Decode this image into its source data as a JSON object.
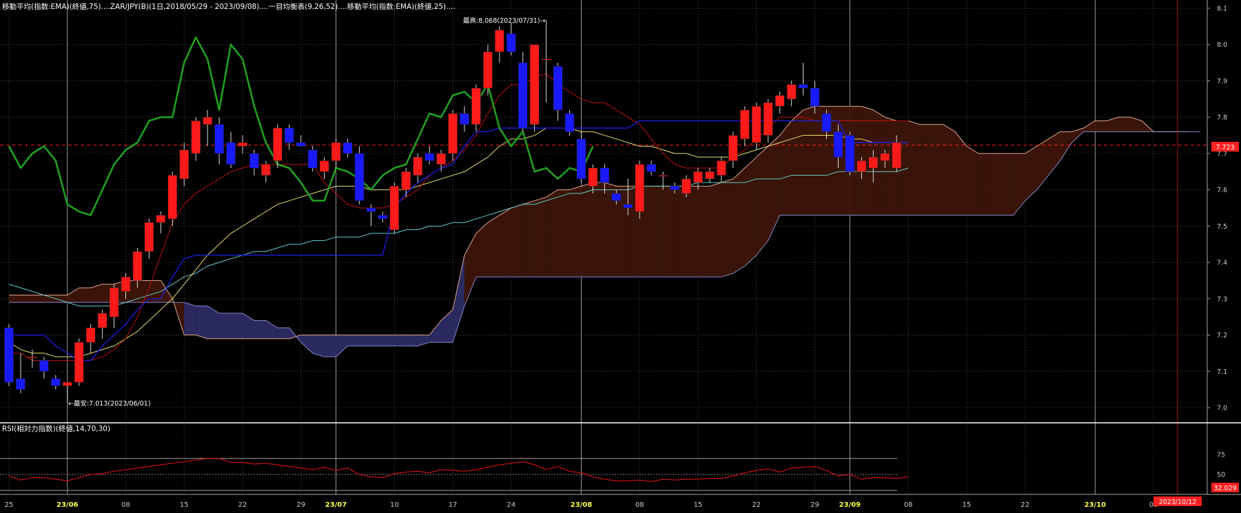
{
  "main_legend": "移動平均(指数:EMA)(終値,75)....ZAR/JPY(B)(1日,2018/05/29 - 2023/09/08)....一目均衡表(9,26,52)....移動平均(指数:EMA)(終値,25)....",
  "rsi_legend": "RSI(相対力指数)(終値,14,70,30)",
  "colors": {
    "background": "#000000",
    "up_candle": "#ff1a1a",
    "down_candle": "#1a1aff",
    "ema75": "#66cccc",
    "ema25": "#e8e070",
    "tenkan": "#2020ff",
    "kijun": "#c01010",
    "chikou": "#20a020",
    "kumo_bull_fill": "#3a1408",
    "kumo_bear_fill": "#2a2a60",
    "rsi": "#e01010",
    "current_price": "#ff2020",
    "date_label": "#ffff40"
  },
  "chart_data": {
    "type": "candlestick",
    "symbol": "ZAR/JPY(B)",
    "ylim": [
      6.97,
      8.12
    ],
    "yticks": [
      "8.1",
      "8.0",
      "7.9",
      "7.8",
      "7.7",
      "7.6",
      "7.5",
      "7.4",
      "7.3",
      "7.2",
      "7.1",
      "7.0"
    ],
    "current_price": "7.723",
    "high_annotation": "最高:8.068(2023/07/31)→",
    "low_annotation": "←最安:7.013(2023/06/01)",
    "x_labels": [
      {
        "i": 0,
        "t": "25",
        "hl": false
      },
      {
        "i": 5,
        "t": "23/06",
        "hl": true
      },
      {
        "i": 10,
        "t": "08",
        "hl": false
      },
      {
        "i": 15,
        "t": "15",
        "hl": false
      },
      {
        "i": 20,
        "t": "22",
        "hl": false
      },
      {
        "i": 25,
        "t": "29",
        "hl": false
      },
      {
        "i": 28,
        "t": "23/07",
        "hl": true
      },
      {
        "i": 33,
        "t": "10",
        "hl": false
      },
      {
        "i": 38,
        "t": "17",
        "hl": false
      },
      {
        "i": 43,
        "t": "24",
        "hl": false
      },
      {
        "i": 49,
        "t": "23/08",
        "hl": true
      },
      {
        "i": 54,
        "t": "08",
        "hl": false
      },
      {
        "i": 59,
        "t": "15",
        "hl": false
      },
      {
        "i": 64,
        "t": "22",
        "hl": false
      },
      {
        "i": 69,
        "t": "29",
        "hl": false
      },
      {
        "i": 72,
        "t": "23/09",
        "hl": true
      },
      {
        "i": 77,
        "t": "08",
        "hl": false
      },
      {
        "i": 82,
        "t": "15",
        "hl": false
      },
      {
        "i": 87,
        "t": "22",
        "hl": false
      },
      {
        "i": 93,
        "t": "23/10",
        "hl": true
      },
      {
        "i": 98,
        "t": "09",
        "hl": false
      }
    ],
    "date_box": "2023/10/12",
    "candles": [
      [
        7.22,
        7.23,
        7.06,
        7.07
      ],
      [
        7.08,
        7.15,
        7.04,
        7.05
      ],
      [
        7.14,
        7.16,
        7.11,
        7.14
      ],
      [
        7.13,
        7.14,
        7.08,
        7.1
      ],
      [
        7.08,
        7.09,
        7.05,
        7.06
      ],
      [
        7.06,
        7.07,
        7.013,
        7.07
      ],
      [
        7.07,
        7.19,
        7.06,
        7.18
      ],
      [
        7.18,
        7.23,
        7.15,
        7.22
      ],
      [
        7.22,
        7.27,
        7.19,
        7.26
      ],
      [
        7.25,
        7.34,
        7.22,
        7.33
      ],
      [
        7.32,
        7.37,
        7.3,
        7.36
      ],
      [
        7.35,
        7.44,
        7.33,
        7.43
      ],
      [
        7.43,
        7.52,
        7.41,
        7.51
      ],
      [
        7.51,
        7.54,
        7.48,
        7.53
      ],
      [
        7.52,
        7.65,
        7.5,
        7.64
      ],
      [
        7.63,
        7.73,
        7.61,
        7.71
      ],
      [
        7.7,
        7.8,
        7.68,
        7.79
      ],
      [
        7.78,
        7.82,
        7.72,
        7.8
      ],
      [
        7.78,
        7.8,
        7.67,
        7.7
      ],
      [
        7.73,
        7.76,
        7.66,
        7.67
      ],
      [
        7.72,
        7.75,
        7.7,
        7.73
      ],
      [
        7.7,
        7.71,
        7.64,
        7.66
      ],
      [
        7.64,
        7.68,
        7.62,
        7.67
      ],
      [
        7.68,
        7.78,
        7.66,
        7.77
      ],
      [
        7.77,
        7.78,
        7.71,
        7.73
      ],
      [
        7.73,
        7.75,
        7.72,
        7.72
      ],
      [
        7.71,
        7.72,
        7.65,
        7.66
      ],
      [
        7.65,
        7.69,
        7.63,
        7.68
      ],
      [
        7.68,
        7.74,
        7.66,
        7.73
      ],
      [
        7.73,
        7.74,
        7.69,
        7.7
      ],
      [
        7.7,
        7.72,
        7.56,
        7.57
      ],
      [
        7.55,
        7.56,
        7.5,
        7.54
      ],
      [
        7.53,
        7.54,
        7.51,
        7.52
      ],
      [
        7.49,
        7.62,
        7.48,
        7.61
      ],
      [
        7.6,
        7.66,
        7.58,
        7.65
      ],
      [
        7.64,
        7.7,
        7.62,
        7.69
      ],
      [
        7.7,
        7.72,
        7.67,
        7.68
      ],
      [
        7.67,
        7.71,
        7.65,
        7.7
      ],
      [
        7.7,
        7.82,
        7.68,
        7.81
      ],
      [
        7.81,
        7.83,
        7.76,
        7.78
      ],
      [
        7.78,
        7.89,
        7.76,
        7.88
      ],
      [
        7.88,
        8.0,
        7.86,
        7.98
      ],
      [
        7.98,
        8.05,
        7.95,
        8.04
      ],
      [
        8.03,
        8.06,
        7.97,
        7.98
      ],
      [
        7.95,
        7.98,
        7.76,
        7.77
      ],
      [
        7.78,
        8.0,
        7.76,
        8.0
      ],
      [
        7.96,
        8.068,
        7.84,
        7.96
      ],
      [
        7.94,
        7.95,
        7.79,
        7.82
      ],
      [
        7.81,
        7.82,
        7.75,
        7.76
      ],
      [
        7.74,
        7.76,
        7.62,
        7.63
      ],
      [
        7.61,
        7.67,
        7.59,
        7.66
      ],
      [
        7.66,
        7.67,
        7.59,
        7.62
      ],
      [
        7.59,
        7.6,
        7.56,
        7.57
      ],
      [
        7.56,
        7.63,
        7.53,
        7.55
      ],
      [
        7.54,
        7.68,
        7.52,
        7.67
      ],
      [
        7.67,
        7.68,
        7.64,
        7.65
      ],
      [
        7.64,
        7.65,
        7.6,
        7.64
      ],
      [
        7.61,
        7.62,
        7.59,
        7.6
      ],
      [
        7.59,
        7.64,
        7.58,
        7.63
      ],
      [
        7.62,
        7.66,
        7.6,
        7.65
      ],
      [
        7.63,
        7.66,
        7.62,
        7.65
      ],
      [
        7.64,
        7.69,
        7.62,
        7.68
      ],
      [
        7.68,
        7.76,
        7.66,
        7.75
      ],
      [
        7.74,
        7.83,
        7.72,
        7.82
      ],
      [
        7.73,
        7.84,
        7.71,
        7.83
      ],
      [
        7.75,
        7.85,
        7.73,
        7.84
      ],
      [
        7.83,
        7.87,
        7.81,
        7.86
      ],
      [
        7.85,
        7.9,
        7.83,
        7.89
      ],
      [
        7.89,
        7.95,
        7.86,
        7.88
      ],
      [
        7.88,
        7.9,
        7.81,
        7.83
      ],
      [
        7.81,
        7.82,
        7.74,
        7.76
      ],
      [
        7.76,
        7.78,
        7.66,
        7.69
      ],
      [
        7.75,
        7.76,
        7.64,
        7.65
      ],
      [
        7.65,
        7.69,
        7.63,
        7.68
      ],
      [
        7.66,
        7.71,
        7.62,
        7.69
      ],
      [
        7.68,
        7.71,
        7.66,
        7.7
      ],
      [
        7.66,
        7.75,
        7.65,
        7.73
      ]
    ],
    "ema25": [
      7.18,
      7.16,
      7.15,
      7.15,
      7.14,
      7.14,
      7.14,
      7.15,
      7.16,
      7.17,
      7.19,
      7.21,
      7.24,
      7.27,
      7.3,
      7.34,
      7.38,
      7.42,
      7.45,
      7.48,
      7.5,
      7.52,
      7.54,
      7.56,
      7.57,
      7.58,
      7.59,
      7.6,
      7.61,
      7.61,
      7.61,
      7.6,
      7.6,
      7.6,
      7.6,
      7.61,
      7.62,
      7.63,
      7.64,
      7.65,
      7.67,
      7.69,
      7.72,
      7.74,
      7.74,
      7.75,
      7.77,
      7.77,
      7.77,
      7.76,
      7.76,
      7.75,
      7.74,
      7.73,
      7.72,
      7.72,
      7.71,
      7.7,
      7.7,
      7.69,
      7.69,
      7.69,
      7.69,
      7.7,
      7.71,
      7.72,
      7.73,
      7.74,
      7.75,
      7.75,
      7.75,
      7.75,
      7.74,
      7.74,
      7.73,
      7.73,
      7.73,
      7.73
    ],
    "ema75": [
      7.34,
      7.33,
      7.32,
      7.31,
      7.3,
      7.29,
      7.28,
      7.28,
      7.28,
      7.28,
      7.29,
      7.3,
      7.31,
      7.32,
      7.34,
      7.36,
      7.37,
      7.39,
      7.4,
      7.41,
      7.42,
      7.43,
      7.43,
      7.44,
      7.45,
      7.45,
      7.46,
      7.46,
      7.47,
      7.47,
      7.47,
      7.48,
      7.48,
      7.48,
      7.49,
      7.49,
      7.5,
      7.5,
      7.51,
      7.51,
      7.52,
      7.53,
      7.54,
      7.55,
      7.56,
      7.56,
      7.57,
      7.58,
      7.59,
      7.59,
      7.6,
      7.6,
      7.6,
      7.6,
      7.61,
      7.61,
      7.61,
      7.61,
      7.61,
      7.62,
      7.62,
      7.62,
      7.62,
      7.62,
      7.63,
      7.63,
      7.63,
      7.64,
      7.64,
      7.64,
      7.64,
      7.65,
      7.65,
      7.65,
      7.65,
      7.65,
      7.65,
      7.66
    ],
    "tenkan": [
      7.2,
      7.2,
      7.2,
      7.2,
      7.17,
      7.15,
      7.13,
      7.13,
      7.17,
      7.2,
      7.23,
      7.27,
      7.3,
      7.3,
      7.36,
      7.41,
      7.42,
      7.42,
      7.42,
      7.42,
      7.42,
      7.42,
      7.42,
      7.42,
      7.42,
      7.42,
      7.42,
      7.42,
      7.42,
      7.42,
      7.42,
      7.42,
      7.42,
      7.55,
      7.59,
      7.62,
      7.64,
      7.66,
      7.67,
      7.72,
      7.76,
      7.76,
      7.77,
      7.77,
      7.77,
      7.77,
      7.77,
      7.77,
      7.77,
      7.77,
      7.77,
      7.77,
      7.77,
      7.77,
      7.79,
      7.79,
      7.79,
      7.79,
      7.79,
      7.79,
      7.79,
      7.79,
      7.79,
      7.79,
      7.79,
      7.79,
      7.79,
      7.79,
      7.79,
      7.79,
      7.79,
      7.79,
      7.73,
      7.73,
      7.73,
      7.73,
      7.73,
      7.73
    ],
    "kijun": [
      7.15,
      7.15,
      7.13,
      7.13,
      7.13,
      7.13,
      7.13,
      7.13,
      7.14,
      7.16,
      7.19,
      7.25,
      7.33,
      7.42,
      7.51,
      7.56,
      7.59,
      7.61,
      7.63,
      7.65,
      7.66,
      7.67,
      7.67,
      7.67,
      7.67,
      7.67,
      7.67,
      7.62,
      7.59,
      7.56,
      7.55,
      7.55,
      7.55,
      7.56,
      7.58,
      7.6,
      7.64,
      7.66,
      7.68,
      7.71,
      7.75,
      7.81,
      7.86,
      7.89,
      7.89,
      7.91,
      7.92,
      7.89,
      7.87,
      7.85,
      7.84,
      7.84,
      7.82,
      7.8,
      7.78,
      7.74,
      7.7,
      7.67,
      7.66,
      7.66,
      7.66,
      7.66,
      7.69,
      7.71,
      7.74,
      7.77,
      7.8,
      7.8,
      7.8,
      7.79,
      7.79,
      7.79,
      7.79,
      7.79,
      7.79,
      7.79,
      7.79,
      7.79
    ],
    "chikou": [
      7.72,
      7.66,
      7.7,
      7.72,
      7.68,
      7.56,
      7.54,
      7.53,
      7.6,
      7.67,
      7.71,
      7.73,
      7.79,
      7.8,
      7.8,
      7.95,
      8.02,
      7.96,
      7.82,
      8.0,
      7.96,
      7.83,
      7.73,
      7.67,
      7.66,
      7.62,
      7.57,
      7.57,
      7.66,
      7.65,
      7.63,
      7.6,
      7.64,
      7.66,
      7.67,
      7.74,
      7.81,
      7.8,
      7.86,
      7.87,
      7.84,
      7.89,
      7.77,
      7.72,
      7.76,
      7.65,
      7.66,
      7.63,
      7.66,
      7.65,
      7.72
    ],
    "kumo_top": [
      7.31,
      7.31,
      7.31,
      7.31,
      7.31,
      7.31,
      7.33,
      7.33,
      7.34,
      7.34,
      7.35,
      7.35,
      7.35,
      7.35,
      7.3,
      7.2,
      7.2,
      7.19,
      7.19,
      7.19,
      7.19,
      7.19,
      7.19,
      7.19,
      7.19,
      7.2,
      7.2,
      7.2,
      7.2,
      7.2,
      7.2,
      7.2,
      7.2,
      7.2,
      7.2,
      7.2,
      7.2,
      7.24,
      7.27,
      7.42,
      7.48,
      7.51,
      7.53,
      7.55,
      7.56,
      7.57,
      7.58,
      7.6,
      7.6,
      7.61,
      7.62,
      7.62,
      7.61,
      7.61,
      7.61,
      7.61,
      7.61,
      7.61,
      7.61,
      7.61,
      7.61,
      7.62,
      7.63,
      7.66,
      7.69,
      7.72,
      7.75,
      7.79,
      7.82,
      7.83,
      7.83,
      7.83,
      7.83,
      7.83,
      7.82,
      7.8,
      7.79,
      7.79,
      7.78,
      7.78,
      7.78,
      7.76,
      7.72,
      7.7,
      7.7,
      7.7,
      7.7,
      7.7,
      7.72,
      7.74,
      7.76,
      7.76,
      7.77,
      7.79,
      7.79,
      7.8,
      7.8,
      7.79,
      7.76,
      7.76,
      7.76,
      7.76
    ],
    "kumo_bottom": [
      7.29,
      7.29,
      7.29,
      7.29,
      7.29,
      7.29,
      7.29,
      7.29,
      7.29,
      7.29,
      7.29,
      7.29,
      7.29,
      7.29,
      7.29,
      7.29,
      7.28,
      7.28,
      7.26,
      7.26,
      7.26,
      7.24,
      7.24,
      7.22,
      7.22,
      7.18,
      7.15,
      7.14,
      7.14,
      7.17,
      7.17,
      7.17,
      7.17,
      7.17,
      7.17,
      7.17,
      7.18,
      7.18,
      7.18,
      7.28,
      7.36,
      7.36,
      7.36,
      7.36,
      7.36,
      7.36,
      7.36,
      7.36,
      7.36,
      7.36,
      7.36,
      7.36,
      7.36,
      7.36,
      7.36,
      7.36,
      7.36,
      7.36,
      7.36,
      7.36,
      7.36,
      7.36,
      7.37,
      7.39,
      7.42,
      7.46,
      7.53,
      7.53,
      7.53,
      7.53,
      7.53,
      7.53,
      7.53,
      7.53,
      7.53,
      7.53,
      7.53,
      7.53,
      7.53,
      7.53,
      7.53,
      7.53,
      7.53,
      7.53,
      7.53,
      7.53,
      7.53,
      7.57,
      7.6,
      7.64,
      7.68,
      7.73,
      7.76,
      7.76,
      7.76,
      7.76,
      7.76,
      7.76,
      7.76,
      7.76,
      7.76,
      7.76,
      7.76
    ],
    "kumo_bear_ranges": [
      [
        15,
        38
      ]
    ],
    "rsi": {
      "current": "32.029",
      "ylim": [
        30,
        80
      ],
      "yticks": [
        "75",
        "50"
      ],
      "levels": [
        70,
        50,
        30
      ],
      "values": [
        48,
        43,
        46,
        46,
        44,
        42,
        46,
        50,
        51,
        54,
        56,
        58,
        60,
        62,
        64,
        66,
        68,
        70,
        70,
        65,
        65,
        63,
        64,
        62,
        60,
        58,
        56,
        59,
        55,
        58,
        50,
        47,
        46,
        51,
        53,
        54,
        52,
        56,
        55,
        54,
        56,
        59,
        62,
        64,
        66,
        62,
        56,
        60,
        54,
        52,
        47,
        44,
        42,
        42,
        43,
        41,
        44,
        43,
        44,
        44,
        45,
        45,
        48,
        52,
        55,
        57,
        53,
        58,
        59,
        60,
        55,
        48,
        50,
        44,
        46,
        46,
        45,
        47
      ]
    }
  }
}
